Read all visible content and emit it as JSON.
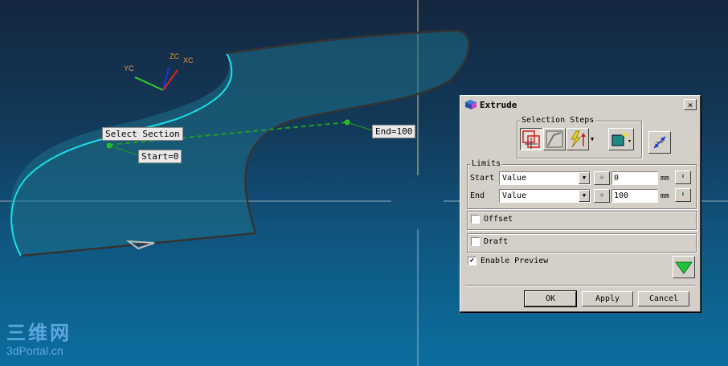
{
  "viewport": {
    "labels": {
      "select_section": "Select Section",
      "start": "Start=0",
      "end": "End=100"
    },
    "axes": {
      "yc": "YC",
      "zc": "ZC",
      "xc": "XC"
    },
    "watermark": {
      "line1": "三维网",
      "line2": "3dPortal.cn"
    }
  },
  "dialog": {
    "title": "Extrude",
    "close_label": "×",
    "selection_steps": {
      "label": "Selection Steps",
      "icons": [
        "section-icon",
        "sketch-section-icon",
        "direction-icon",
        "boolean-icon",
        "reverse-direction-icon"
      ]
    },
    "limits": {
      "label": "Limits",
      "start": {
        "label": "Start",
        "type": "Value",
        "value": "0",
        "unit": "mm"
      },
      "end": {
        "label": "End",
        "type": "Value",
        "value": "100",
        "unit": "mm"
      }
    },
    "offset_label": "Offset",
    "draft_label": "Draft",
    "enable_preview": {
      "label": "Enable Preview",
      "checked": true
    },
    "buttons": {
      "ok": "OK",
      "apply": "Apply",
      "cancel": "Cancel"
    }
  },
  "colors": {
    "section_curve": "#19e0e8",
    "edge_curve": "#333333",
    "preview_line": "#1ca01c",
    "dialog_bg": "#d4d0c8"
  }
}
